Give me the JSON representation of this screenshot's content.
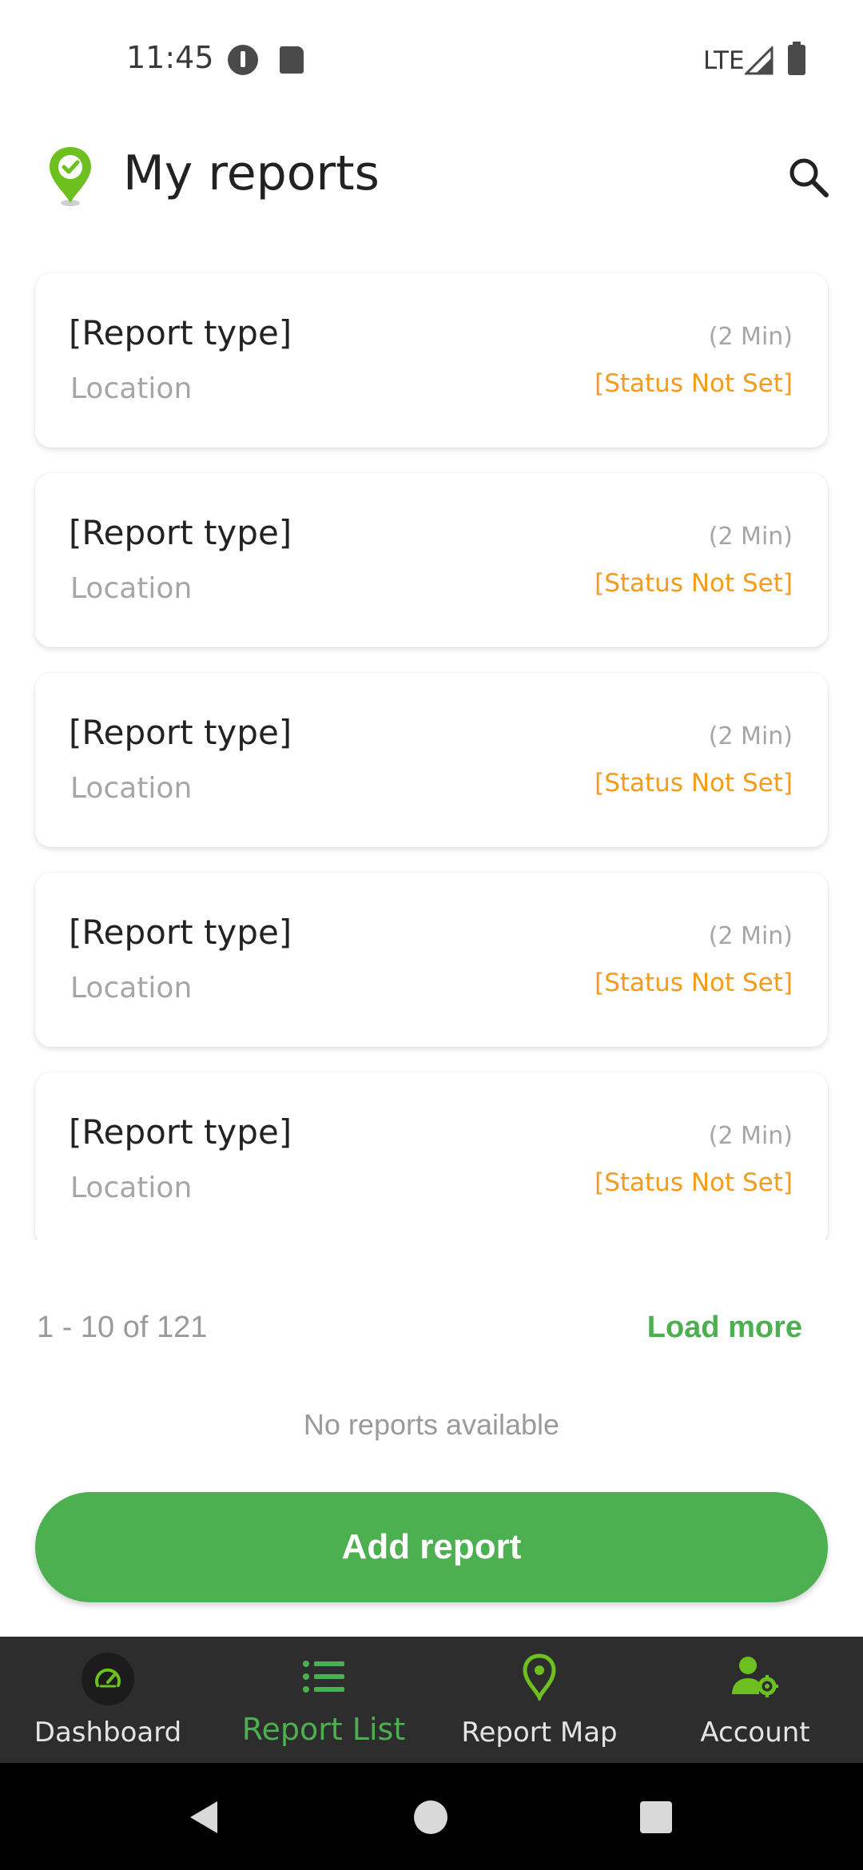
{
  "status_bar": {
    "time": "11:45",
    "network": "LTE"
  },
  "header": {
    "title": "My reports",
    "logo_icon": "location-check-pin-icon",
    "search_icon": "search-icon"
  },
  "reports": [
    {
      "type": "[Report type]",
      "location": "Location",
      "time": "(2 Min)",
      "status": "[Status Not Set]"
    },
    {
      "type": "[Report type]",
      "location": "Location",
      "time": "(2 Min)",
      "status": "[Status Not Set]"
    },
    {
      "type": "[Report type]",
      "location": "Location",
      "time": "(2 Min)",
      "status": "[Status Not Set]"
    },
    {
      "type": "[Report type]",
      "location": "Location",
      "time": "(2 Min)",
      "status": "[Status Not Set]"
    },
    {
      "type": "[Report type]",
      "location": "Location",
      "time": "(2 Min)",
      "status": "[Status Not Set]"
    }
  ],
  "pagination": {
    "text": "1 - 10 of 121",
    "load_more": "Load more"
  },
  "empty_text": "No reports available",
  "add_report": "Add report",
  "bottom_nav": {
    "items": [
      {
        "label": "Dashboard",
        "icon": "speedometer-icon",
        "active": false
      },
      {
        "label": "Report List",
        "icon": "list-icon",
        "active": true
      },
      {
        "label": "Report Map",
        "icon": "map-pin-icon",
        "active": false
      },
      {
        "label": "Account",
        "icon": "account-settings-icon",
        "active": false
      }
    ]
  },
  "colors": {
    "accent": "#4caf50",
    "status": "#f59b1b",
    "nav_background": "#2d2d2d"
  }
}
